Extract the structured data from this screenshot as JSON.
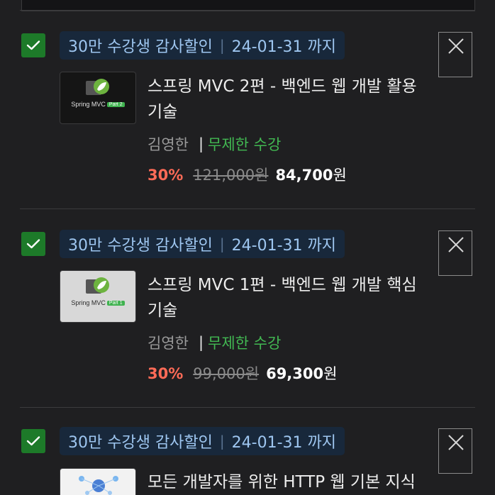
{
  "items": [
    {
      "discount_label": "30만 수강생 감사할인",
      "discount_date": "24-01-31 까지",
      "title_line1": "스프링 MVC 2편 - 백엔드 웹 개발 활용",
      "title_line2": "기술",
      "thumb_title": "Spring MVC",
      "thumb_badge": "Part 2",
      "instructor": "김영한",
      "access_sep": "|",
      "access": "무제한 수강",
      "percent": "30%",
      "original_price": "121,000원",
      "final_price": "84,700",
      "currency": "원",
      "checked": true
    },
    {
      "discount_label": "30만 수강생 감사할인",
      "discount_date": "24-01-31 까지",
      "title_line1": "스프링 MVC 1편 - 백엔드 웹 개발 핵심",
      "title_line2": "기술",
      "thumb_title": "Spring MVC",
      "thumb_badge": "Part 1",
      "instructor": "김영한",
      "access_sep": "|",
      "access": "무제한 수강",
      "percent": "30%",
      "original_price": "99,000원",
      "final_price": "69,300",
      "currency": "원",
      "checked": true
    },
    {
      "discount_label": "30만 수강생 감사할인",
      "discount_date": "24-01-31 까지",
      "title_line1": "모든 개발자를 위한 HTTP 웹 기본 지식",
      "checked": true
    }
  ],
  "colors": {
    "background": "#1f1f21",
    "checkbox": "#1d7a29",
    "discount_pill_bg": "#18283b",
    "discount_text": "#9ec6f0",
    "access_green": "#42b852",
    "percent_red": "#ff6b57"
  },
  "icons": {
    "checkbox": "check-icon",
    "remove": "close-icon"
  }
}
